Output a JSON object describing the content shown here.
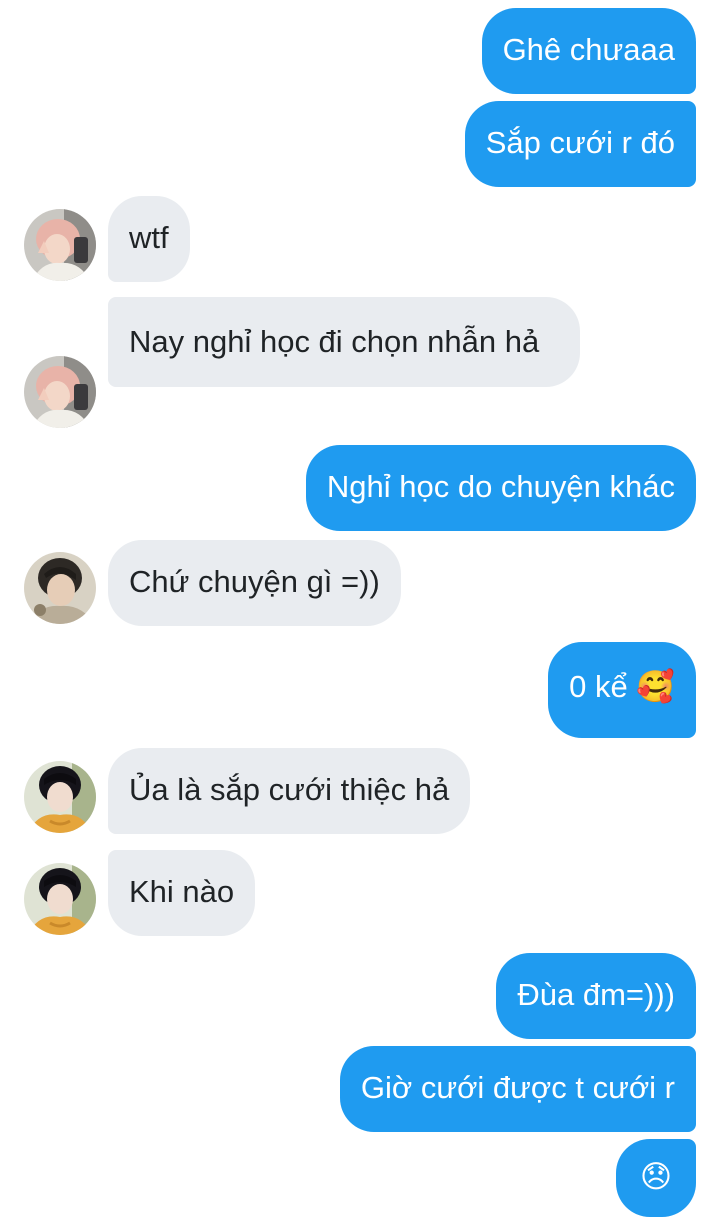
{
  "messages": [
    {
      "dir": "out",
      "text": "Ghê chưaaa"
    },
    {
      "dir": "out",
      "text": "Sắp cưới r đó"
    },
    {
      "dir": "in",
      "text": "wtf",
      "avatar": "avatar-pink-hair-icon"
    },
    {
      "dir": "in",
      "text": "Nay nghỉ học đi chọn nhẫn hả",
      "avatar": "avatar-pink-hair-icon"
    },
    {
      "dir": "out",
      "text": "Nghỉ học do chuyện khác"
    },
    {
      "dir": "in",
      "text": "Chứ chuyện gì =))",
      "avatar": "avatar-dark-hair-icon"
    },
    {
      "dir": "out",
      "text": "0 kể",
      "emoji": "🥰"
    },
    {
      "dir": "in",
      "text": "Ủa là sắp cưới thiệc hả",
      "avatar": "avatar-black-hair-icon"
    },
    {
      "dir": "in",
      "text": "Khi nào",
      "avatar": "avatar-black-hair-icon"
    },
    {
      "dir": "out",
      "text": "Đùa đm=)))"
    },
    {
      "dir": "out",
      "text": "Giờ cưới được t cưới r"
    },
    {
      "dir": "out",
      "text": "",
      "emoji": "😞"
    }
  ],
  "colors": {
    "outgoing_bubble": "#1f9bf0",
    "incoming_bubble": "#e9ecf0",
    "outgoing_text": "#ffffff",
    "incoming_text": "#1f2326"
  }
}
